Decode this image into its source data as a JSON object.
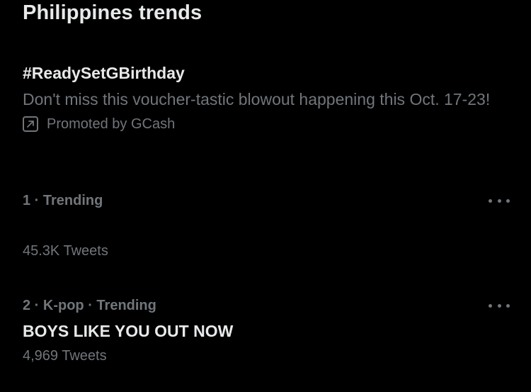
{
  "header": {
    "title": "Philippines trends"
  },
  "promoted": {
    "hashtag": "#ReadySetGBirthday",
    "description": "Don't miss this voucher-tastic blowout happening this Oct. 17-23!",
    "promoted_by": "Promoted by GCash",
    "icon": "promoted-arrow-icon"
  },
  "trends": [
    {
      "meta": "1 · Trending",
      "name": "",
      "count": "45.3K Tweets",
      "more_icon": "more-dots-icon"
    },
    {
      "meta": "2 · K-pop · Trending",
      "name": "BOYS LIKE YOU OUT NOW",
      "count": "4,969 Tweets",
      "more_icon": "more-dots-icon"
    }
  ],
  "colors": {
    "background": "#000000",
    "primary_text": "#e7e9ea",
    "secondary_text": "#71767b"
  }
}
